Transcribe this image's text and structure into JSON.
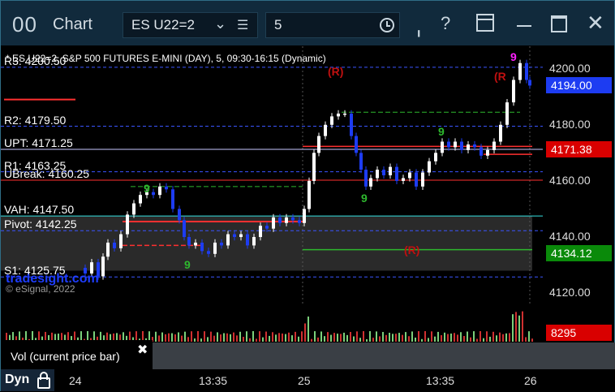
{
  "window": {
    "app_icon": "00",
    "title": "Chart",
    "symbol": "ES U22=2",
    "interval": "5"
  },
  "chart": {
    "header": "* ES U22=2, S&P 500 FUTURES E-MINI (DAY), 5, 09:30-16:15 (Dynamic)",
    "watermark": "tradesight.com",
    "copyright": "© eSignal, 2022",
    "levels": [
      {
        "key": "r3",
        "label": "R3: 4200.50",
        "price": 4200.5,
        "color": "#3a55ff",
        "style": "dashed"
      },
      {
        "key": "r2",
        "label": "R2: 4179.50",
        "price": 4179.5,
        "color": "#3a55ff",
        "style": "dashed"
      },
      {
        "key": "upt",
        "label": "UPT: 4171.25",
        "price": 4171.25,
        "color": "#c8c8ff",
        "style": "solid"
      },
      {
        "key": "r1",
        "label": "R1: 4163.25",
        "price": 4163.25,
        "color": "#3a55ff",
        "style": "dashed"
      },
      {
        "key": "ubreak",
        "label": "UBreak: 4160.25",
        "price": 4160.25,
        "color": "#ff3030",
        "style": "solid"
      },
      {
        "key": "vah",
        "label": "VAH: 4147.50",
        "price": 4147.5,
        "color": "#35e0e0",
        "style": "solid"
      },
      {
        "key": "pivot",
        "label": "Pivot: 4142.25",
        "price": 4142.25,
        "color": "#3a55ff",
        "style": "dashed"
      },
      {
        "key": "s1",
        "label": "S1: 4125.75",
        "price": 4125.75,
        "color": "#3a55ff",
        "style": "dashed"
      }
    ],
    "price_axis": {
      "ticks": [
        "4200.00",
        "4180.00",
        "4160.00",
        "4140.00",
        "4120.00"
      ],
      "tick_values": [
        4200,
        4180,
        4160,
        4140,
        4120
      ],
      "ymin": 4116,
      "ymax": 4208
    },
    "badges": [
      {
        "label": "4194.00",
        "price": 4194.0,
        "bg": "#1d3cf2"
      },
      {
        "label": "4171.38",
        "price": 4171.38,
        "bg": "#d90000"
      },
      {
        "label": "4134.12",
        "price": 4134.12,
        "bg": "#0a8a0a"
      }
    ],
    "annotations": [
      "(R)",
      "(R)",
      "(R"
    ],
    "seq_numbers": [
      "9",
      "9",
      "9",
      "9",
      "9"
    ]
  },
  "volume": {
    "indicator": "Vol (current price bar)",
    "value": "8295"
  },
  "time_axis": {
    "mode": "Dyn",
    "labels": [
      "24",
      "13:35",
      "25",
      "13:35",
      "26"
    ]
  },
  "colors": {
    "titlebar": "#112a3c",
    "up_candle": "#ffffff",
    "down_candle": "#1d3cf2",
    "annotation_red": "#c01010",
    "seq_green": "#2eb82e",
    "seq_magenta": "#ff20ff"
  },
  "icons": [
    "pin-icon",
    "help-icon",
    "layout-icon",
    "minimize-icon",
    "maximize-icon",
    "close-icon",
    "list-icon",
    "clock-icon",
    "lock-icon",
    "chevron-down-icon"
  ]
}
